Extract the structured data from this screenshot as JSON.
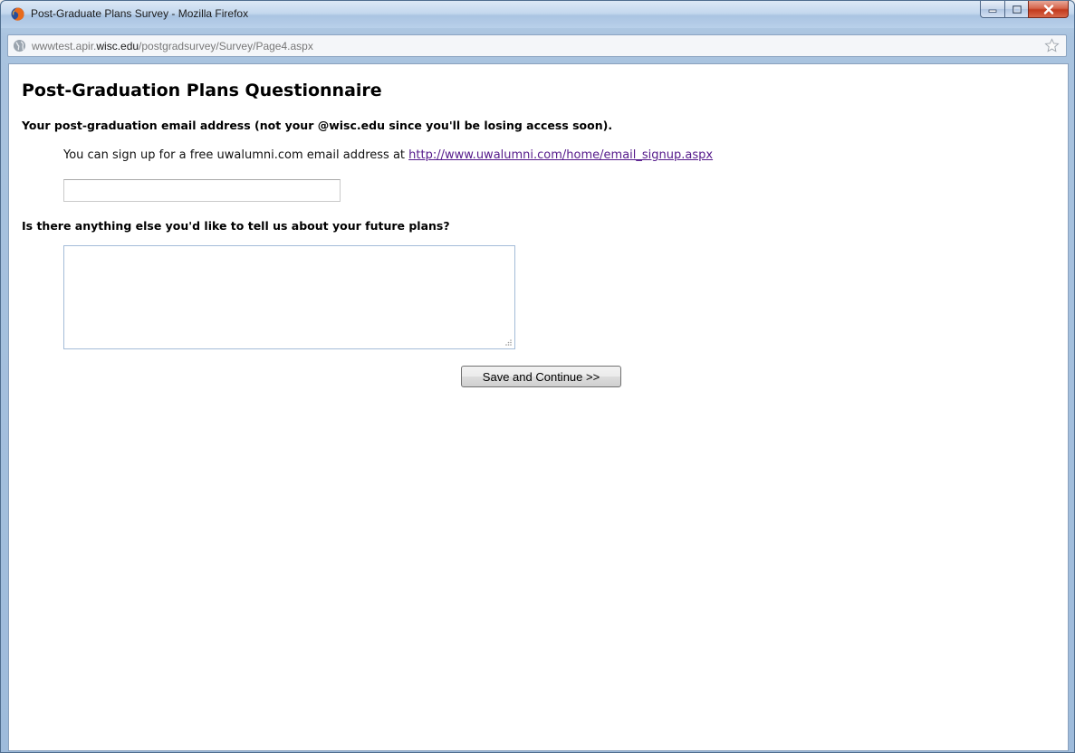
{
  "window": {
    "title": "Post-Graduate Plans Survey - Mozilla Firefox",
    "minimize_label": "–",
    "maximize_label": "□",
    "close_label": "x"
  },
  "address_bar": {
    "url_prefix": "wwwtest.apir.",
    "url_domain": "wisc.edu",
    "url_suffix": "/postgradsurvey/Survey/Page4.aspx"
  },
  "page": {
    "title": "Post-Graduation Plans Questionnaire",
    "email_question": "Your post-graduation email address (not your @wisc.edu since you'll be losing access soon).",
    "email_hint_text": "You can sign up for a free uwalumni.com email address at ",
    "email_hint_link": "http://www.uwalumni.com/home/email_signup.aspx",
    "email_value": "",
    "plans_question": "Is there anything else you'd like to tell us about your future plans?",
    "plans_value": "",
    "save_button_label": "Save and Continue >>"
  },
  "colors": {
    "link_visited": "#551a8b",
    "titlebar": "#c4d8ee",
    "close_button": "#c23a1d"
  },
  "icons": [
    "firefox-icon",
    "globe-icon",
    "bookmark-star-icon",
    "minimize-icon",
    "maximize-icon",
    "close-icon",
    "resize-grip-icon"
  ]
}
